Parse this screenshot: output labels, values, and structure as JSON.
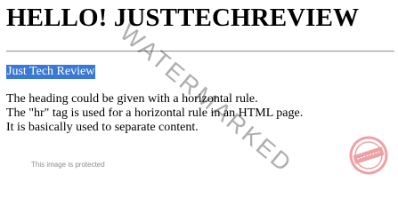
{
  "page": {
    "heading": "HELLO! JUSTTECHREVIEW",
    "selected_text": "Just Tech Review",
    "paragraph_lines": [
      "The heading could be given with a horizontal rule.",
      "The \"hr\" tag is used for a horizontal rule in an HTML page.",
      "It is basically used to separate content."
    ]
  },
  "overlay": {
    "watermark_text": "WATERMARKED",
    "protected_note": "This image is protected",
    "stamp_color": "#e0565b"
  },
  "colors": {
    "selection_background": "#3a78d6",
    "selection_text": "#ffffff",
    "text": "#000000"
  }
}
